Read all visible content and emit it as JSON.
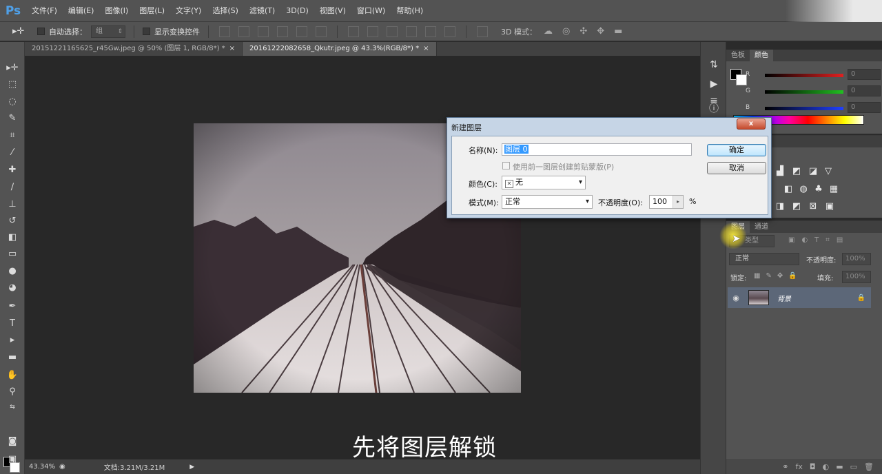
{
  "app": {
    "logo": "Ps"
  },
  "menu": [
    "文件(F)",
    "编辑(E)",
    "图像(I)",
    "图层(L)",
    "文字(Y)",
    "选择(S)",
    "滤镜(T)",
    "3D(D)",
    "视图(V)",
    "窗口(W)",
    "帮助(H)"
  ],
  "options": {
    "auto_select_label": "自动选择：",
    "auto_select_value": "组",
    "show_transform_label": "显示变换控件",
    "mode_3d_label": "3D 模式："
  },
  "tabs": [
    {
      "label": "20151221165625_r45Gw.jpeg @ 50% (图层 1, RGB/8*) *",
      "close": "×"
    },
    {
      "label": "20161222082658_Qkutr.jpeg @ 43.3%(RGB/8*) *",
      "close": "×"
    }
  ],
  "status": {
    "zoom": "43.34%",
    "doc": "文档:3.21M/3.21M"
  },
  "subtitle": "先将图层解锁",
  "color_panel": {
    "tabs": [
      "色板",
      "颜色"
    ],
    "channels": [
      {
        "name": "R",
        "value": "0",
        "color": "#e02020"
      },
      {
        "name": "G",
        "value": "0",
        "color": "#20c020"
      },
      {
        "name": "B",
        "value": "0",
        "color": "#2040ff"
      }
    ]
  },
  "layers_panel": {
    "tabs": [
      "图层",
      "通道"
    ],
    "filter": "类型",
    "blend_mode": "正常",
    "opacity_label": "不透明度:",
    "opacity_value": "100%",
    "lock_label": "锁定:",
    "fill_label": "填充:",
    "fill_value": "100%",
    "layer_name": "背景"
  },
  "dialog": {
    "title": "新建图层",
    "close": "x",
    "name_label": "名称(N):",
    "name_value": "图层 0",
    "clip_label": "使用前一图层创建剪贴蒙版(P)",
    "color_label": "颜色(C):",
    "color_value": "无",
    "mode_label": "模式(M):",
    "mode_value": "正常",
    "opacity_label": "不透明度(O):",
    "opacity_value": "100",
    "opacity_unit": "%",
    "ok": "确定",
    "cancel": "取消"
  }
}
